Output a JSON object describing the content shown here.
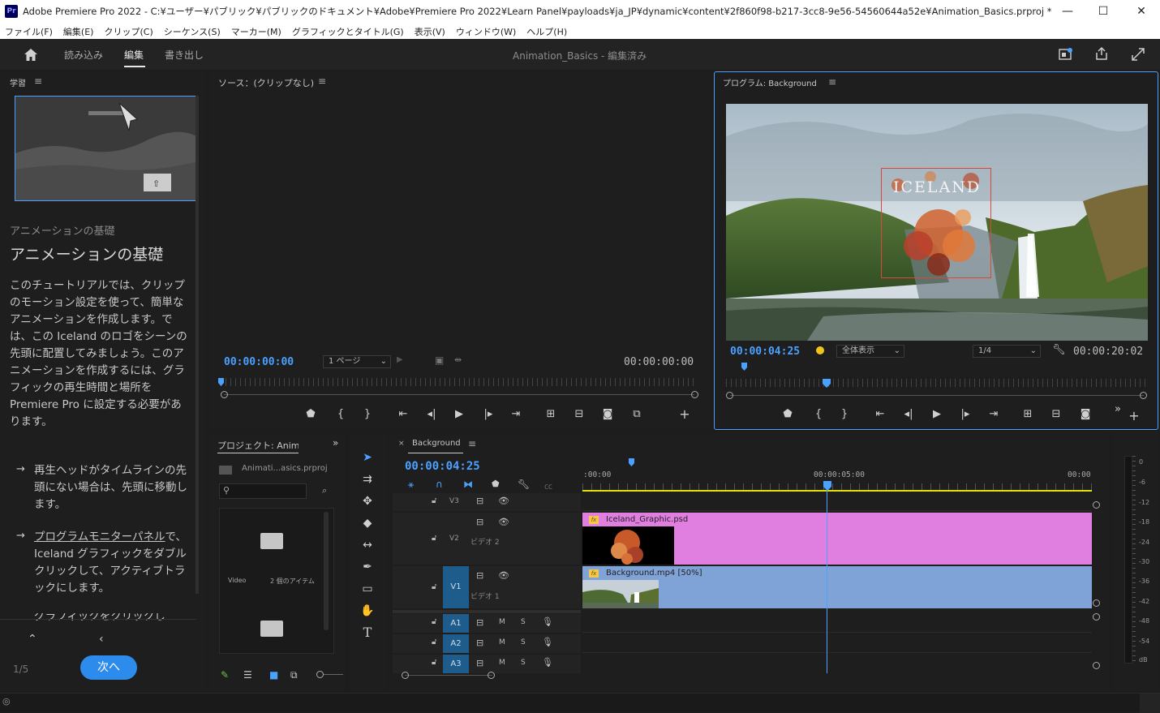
{
  "window": {
    "app_icon": "Pr",
    "title": "Adobe Premiere Pro 2022 - C:¥ユーザー¥パブリック¥パブリックのドキュメント¥Adobe¥Premiere Pro 2022¥Learn Panel¥payloads¥ja_JP¥dynamic¥content¥2f860f98-b217-3cc8-9e56-54560644a52e¥Animation_Basics.prproj *",
    "minimize": "—",
    "maximize": "☐",
    "close": "✕"
  },
  "menu": [
    "ファイル(F)",
    "編集(E)",
    "クリップ(C)",
    "シーケンス(S)",
    "マーカー(M)",
    "グラフィックとタイトル(G)",
    "表示(V)",
    "ウィンドウ(W)",
    "ヘルプ(H)"
  ],
  "header": {
    "tabs": [
      "読み込み",
      "編集",
      "書き出し"
    ],
    "active_tab": "編集",
    "project_name": "Animation_Basics",
    "status": " - 編集済み"
  },
  "learn": {
    "panel_title": "学習",
    "subtitle": "アニメーションの基礎",
    "title": "アニメーションの基礎",
    "body": "このチュートリアルでは、クリップのモーション設定を使って、簡単なアニメーションを作成します。では、この Iceland のロゴをシーンの先頭に配置してみましょう。このアニメーションを作成するには、グラフィックの再生時間と場所を Premiere Pro に設定する必要があります。",
    "step1": "再生ヘッドがタイムラインの先頭にない場合は、先頭に移動します。",
    "step2_link": "プログラムモニターパネル",
    "step2_rest": "で、Iceland グラフィックをダブルクリックして、アクティブトラックにします。",
    "step3": "グラフィックをクリックし",
    "page": "1/5",
    "next_label": "次へ"
  },
  "source": {
    "title": "ソース：(クリップなし)",
    "timecode_in": "00:00:00:00",
    "page_select": "1 ページ",
    "timecode_out": "00:00:00:00"
  },
  "program": {
    "title": "プログラム: Background",
    "overlay_text": "ICELAND",
    "timecode": "00:00:04:25",
    "fit": "全体表示",
    "resolution": "1/4",
    "duration": "00:00:20:02"
  },
  "project": {
    "title": "プロジェクト: Animation_Basics",
    "file": "Animati...asics.prproj",
    "search_placeholder": "",
    "bin_name": "Video",
    "bin_count": "2 個のアイテム"
  },
  "timeline": {
    "sequence": "Background",
    "timecode": "00:00:04:25",
    "ruler": [
      ":00:00",
      "00:00:05:00",
      "00:00"
    ],
    "tracks": {
      "v3": "V3",
      "v2": "V2",
      "v2_name": "ビデオ 2",
      "v1": "V1",
      "v1_name": "ビデオ 1",
      "a1": "A1",
      "a2": "A2",
      "a3": "A3",
      "mute": "M",
      "solo": "S"
    },
    "clip_graphic": "Iceland_Graphic.psd",
    "clip_video": "Background.mp4 [50%]",
    "fx": "fx"
  },
  "meter": [
    "0",
    "-6",
    "-12",
    "-18",
    "-24",
    "-30",
    "-36",
    "-42",
    "-48",
    "-54",
    "dB"
  ],
  "colors": {
    "accent_blue": "#4aa1ff",
    "graphic_clip": "#e17fe0",
    "video_clip": "#7fa2d7",
    "track_target": "#1e5c8c",
    "next_button": "#2d8ceb"
  }
}
